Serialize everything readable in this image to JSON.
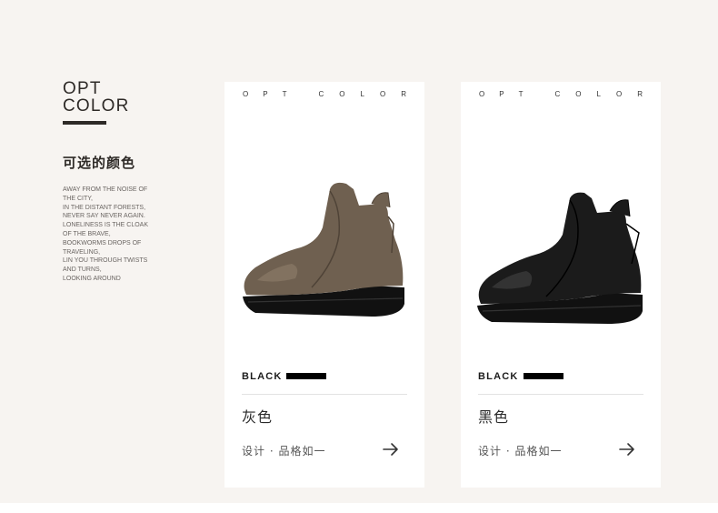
{
  "left": {
    "brand_title": "OPT\nCOLOR",
    "heading": "可选的颜色",
    "poem": [
      "AWAY FROM THE NOISE OF",
      "THE CITY,",
      "IN THE DISTANT FORESTS,",
      "NEVER SAY NEVER AGAIN.",
      "LONELINESS IS THE CLOAK",
      "OF THE BRAVE,",
      "BOOKWORMS DROPS OF",
      "TRAVELING,",
      "LIN YOU THROUGH TWISTS",
      "AND TURNS,",
      "LOOKING AROUND"
    ]
  },
  "cards": [
    {
      "top_word_1": [
        "O",
        "P",
        "T"
      ],
      "top_word_2": [
        "C",
        "O",
        "L",
        "O",
        "R"
      ],
      "color_label": "BLACK",
      "color_name": "灰色",
      "design_note": "设计 · 品格如一",
      "shoe_color": "#6f6050",
      "shoe_highlight": "#8a7a67"
    },
    {
      "top_word_1": [
        "O",
        "P",
        "T"
      ],
      "top_word_2": [
        "C",
        "O",
        "L",
        "O",
        "R"
      ],
      "color_label": "BLACK",
      "color_name": "黑色",
      "design_note": "设计 · 品格如一",
      "shoe_color": "#1b1b1b",
      "shoe_highlight": "#3a3a3a"
    }
  ],
  "colors": {
    "background": "#f7f4f1",
    "card": "#ffffff",
    "text_dark": "#2e2a27"
  },
  "icons": [
    "arrow-right-icon"
  ]
}
